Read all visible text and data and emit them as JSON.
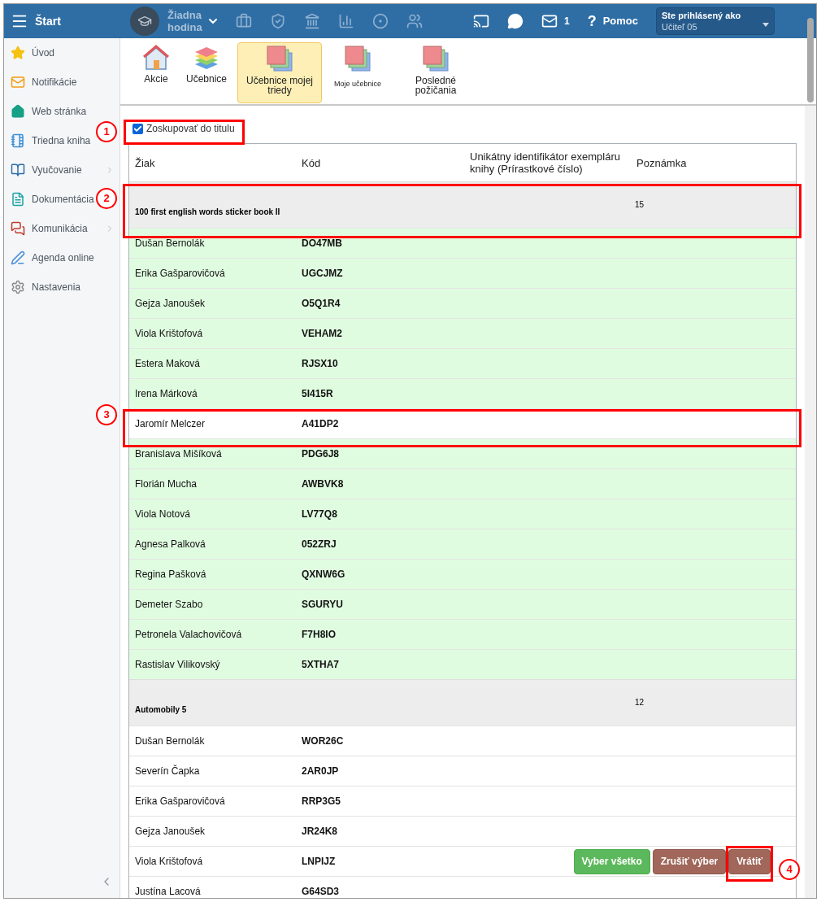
{
  "topbar": {
    "menu_label": "Štart",
    "lesson": "Žiadna hodina",
    "mail_count": "1",
    "help_glyph": "?",
    "help_label": "Pomoc",
    "user": {
      "caption": "Ste prihlásený ako",
      "name": "Učiteľ 05"
    }
  },
  "sidebar": {
    "items": [
      {
        "label": "Úvod",
        "expandable": false
      },
      {
        "label": "Notifikácie",
        "expandable": false
      },
      {
        "label": "Web stránka",
        "expandable": false
      },
      {
        "label": "Triedna kniha",
        "expandable": false
      },
      {
        "label": "Vyučovanie",
        "expandable": true
      },
      {
        "label": "Dokumentácia",
        "expandable": false
      },
      {
        "label": "Komunikácia",
        "expandable": true
      },
      {
        "label": "Agenda online",
        "expandable": false
      },
      {
        "label": "Nastavenia",
        "expandable": false
      }
    ]
  },
  "toolbar": {
    "items": [
      {
        "label": "Akcie",
        "selected": false
      },
      {
        "label": "Učebnice",
        "selected": false
      },
      {
        "label": "Učebnice mojej triedy",
        "selected": true
      },
      {
        "label": "Moje učebnice",
        "selected": false
      },
      {
        "label": "Posledné požičania",
        "selected": false
      }
    ]
  },
  "group_checkbox": {
    "label": "Zoskupovať do titulu",
    "checked": true
  },
  "table": {
    "columns": [
      "Žiak",
      "Kód",
      "Unikátny identifikátor exempláru knihy (Prírastkové číslo)",
      "Poznámka"
    ],
    "groups": [
      {
        "title": "100 first english words sticker book II",
        "count": "15",
        "rows": [
          {
            "student": "Dušan Bernolák",
            "code": "DO47MB",
            "selected": true
          },
          {
            "student": "Erika Gašparovičová",
            "code": "UGCJMZ",
            "selected": true
          },
          {
            "student": "Gejza Janoušek",
            "code": "O5Q1R4",
            "selected": true
          },
          {
            "student": "Viola Krištofová",
            "code": "VEHAM2",
            "selected": true
          },
          {
            "student": "Estera Maková",
            "code": "RJSX10",
            "selected": true
          },
          {
            "student": "Irena Márková",
            "code": "5I415R",
            "selected": true
          },
          {
            "student": "Jaromír Melczer",
            "code": "A41DP2",
            "selected": false
          },
          {
            "student": "Branislava Mišíková",
            "code": "PDG6J8",
            "selected": true
          },
          {
            "student": "Florián Mucha",
            "code": "AWBVK8",
            "selected": true
          },
          {
            "student": "Viola Notová",
            "code": "LV77Q8",
            "selected": true
          },
          {
            "student": "Agnesa Palková",
            "code": "052ZRJ",
            "selected": true
          },
          {
            "student": "Regina Pašková",
            "code": "QXNW6G",
            "selected": true
          },
          {
            "student": "Demeter Szabo",
            "code": "SGURYU",
            "selected": true
          },
          {
            "student": "Petronela Valachovičová",
            "code": "F7H8IO",
            "selected": true
          },
          {
            "student": "Rastislav Vilikovský",
            "code": "5XTHA7",
            "selected": true
          }
        ]
      },
      {
        "title": "Automobily 5",
        "count": "12",
        "rows": [
          {
            "student": "Dušan Bernolák",
            "code": "WOR26C",
            "selected": false
          },
          {
            "student": "Severín Čapka",
            "code": "2AR0JP",
            "selected": false
          },
          {
            "student": "Erika Gašparovičová",
            "code": "RRP3G5",
            "selected": false
          },
          {
            "student": "Gejza Janoušek",
            "code": "JR24K8",
            "selected": false
          },
          {
            "student": "Viola Krištofová",
            "code": "LNPIJZ",
            "selected": false
          },
          {
            "student": "Justína Lacová",
            "code": "G64SD3",
            "selected": false
          }
        ]
      }
    ]
  },
  "buttons": [
    {
      "label": "Vyber všetko",
      "kind": "success"
    },
    {
      "label": "Zrušiť výber",
      "kind": "danger"
    },
    {
      "label": "Vrátiť",
      "kind": "danger"
    }
  ],
  "callouts": [
    "1",
    "2",
    "3",
    "4"
  ]
}
